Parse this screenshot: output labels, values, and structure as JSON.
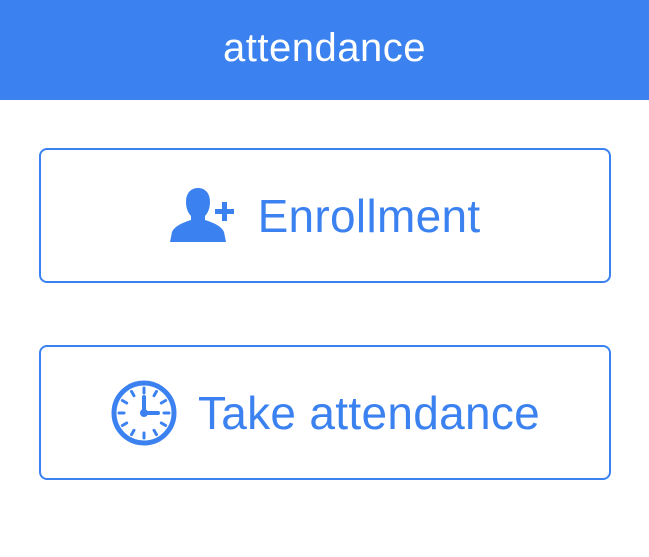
{
  "app_bar": {
    "title": "attendance",
    "color": "#3b82f0"
  },
  "actions": [
    {
      "label": "Enrollment",
      "icon": "add-person-icon"
    },
    {
      "label": "Take attendance",
      "icon": "clock-icon"
    }
  ],
  "accent_color": "#3b82f0"
}
